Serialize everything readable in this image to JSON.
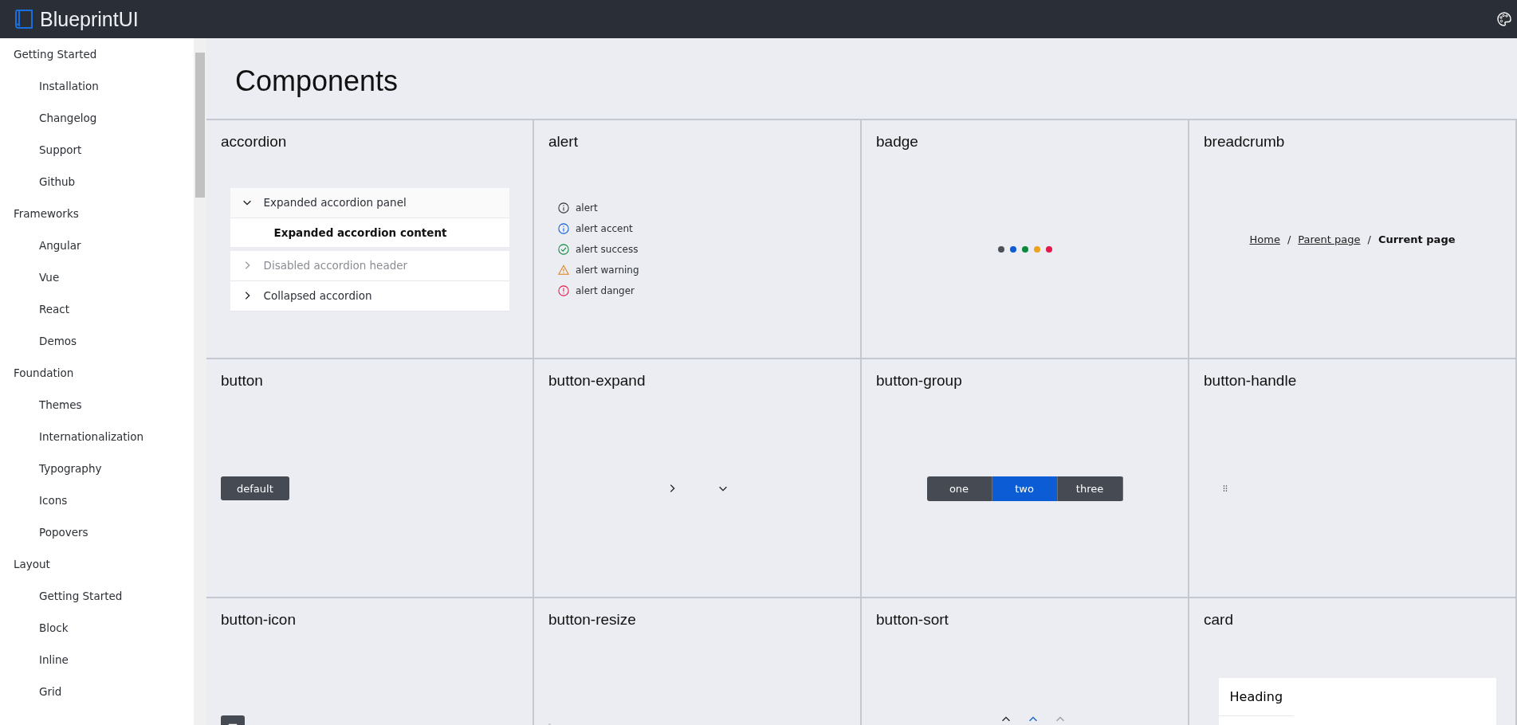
{
  "header": {
    "logo_text": "BlueprintUI"
  },
  "sidebar": {
    "sections": [
      {
        "label": "Getting Started",
        "children": [
          {
            "label": "Installation"
          },
          {
            "label": "Changelog"
          },
          {
            "label": "Support"
          },
          {
            "label": "Github"
          }
        ]
      },
      {
        "label": "Frameworks",
        "children": [
          {
            "label": "Angular"
          },
          {
            "label": "Vue"
          },
          {
            "label": "React"
          },
          {
            "label": "Demos"
          }
        ]
      },
      {
        "label": "Foundation",
        "children": [
          {
            "label": "Themes"
          },
          {
            "label": "Internationalization"
          },
          {
            "label": "Typography"
          },
          {
            "label": "Icons"
          },
          {
            "label": "Popovers"
          }
        ]
      },
      {
        "label": "Layout",
        "children": [
          {
            "label": "Getting Started"
          },
          {
            "label": "Block"
          },
          {
            "label": "Inline"
          },
          {
            "label": "Grid"
          }
        ]
      }
    ]
  },
  "page_title": "Components",
  "cells": [
    {
      "title": "accordion",
      "kind": "accordion",
      "panels": [
        {
          "label": "Expanded accordion panel",
          "expanded": true,
          "disabled": false,
          "content": "Expanded accordion content"
        },
        {
          "label": "Disabled accordion header",
          "expanded": false,
          "disabled": true
        },
        {
          "label": "Collapsed accordion",
          "expanded": false,
          "disabled": false
        }
      ]
    },
    {
      "title": "alert",
      "kind": "alert",
      "alerts": [
        {
          "text": "alert",
          "kind": "neutral"
        },
        {
          "text": "alert accent",
          "kind": "accent"
        },
        {
          "text": "alert success",
          "kind": "success"
        },
        {
          "text": "alert warning",
          "kind": "warning"
        },
        {
          "text": "alert danger",
          "kind": "danger"
        }
      ]
    },
    {
      "title": "badge",
      "kind": "badge",
      "badges": [
        {
          "color": "#4b5059"
        },
        {
          "color": "#0b5cd5"
        },
        {
          "color": "#0a8a3d"
        },
        {
          "color": "#eda21b"
        },
        {
          "color": "#e2194b"
        }
      ]
    },
    {
      "title": "breadcrumb",
      "kind": "breadcrumb",
      "separators": [
        "/",
        "/"
      ],
      "items": [
        {
          "label": "Home",
          "current": false
        },
        {
          "label": "Parent page",
          "current": false
        },
        {
          "label": "Current page",
          "current": true
        }
      ]
    },
    {
      "title": "button",
      "kind": "button",
      "label": "default"
    },
    {
      "title": "button-expand",
      "kind": "expand",
      "toggles": [
        {
          "expanded": false
        },
        {
          "expanded": true
        }
      ]
    },
    {
      "title": "button-group",
      "kind": "group",
      "buttons": [
        {
          "label": "one",
          "selected": false
        },
        {
          "label": "two",
          "selected": true
        },
        {
          "label": "three",
          "selected": false
        }
      ]
    },
    {
      "title": "button-handle",
      "kind": "handle"
    },
    {
      "title": "button-icon",
      "kind": "icon"
    },
    {
      "title": "button-resize",
      "kind": "resize"
    },
    {
      "title": "button-sort",
      "kind": "sort"
    },
    {
      "title": "card",
      "kind": "card",
      "heading": "Heading"
    }
  ]
}
